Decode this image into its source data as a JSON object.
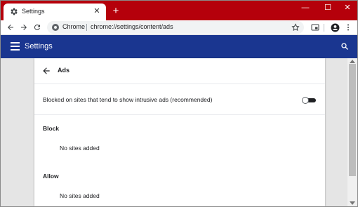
{
  "window": {
    "tab_title": "Settings",
    "tab_close": "✕",
    "new_tab": "+",
    "controls": {
      "minimize": "—",
      "maximize": "☐",
      "close": "✕"
    },
    "titlebar_color": "#b5000b"
  },
  "toolbar": {
    "site_chip": "Chrome",
    "url": "chrome://settings/content/ads"
  },
  "header": {
    "title": "Settings",
    "color": "#1a3690"
  },
  "page": {
    "title": "Ads",
    "setting_label": "Blocked on sites that tend to show intrusive ads (recommended)",
    "toggle_on": false,
    "block": {
      "heading": "Block",
      "empty": "No sites added"
    },
    "allow": {
      "heading": "Allow",
      "empty": "No sites added"
    }
  }
}
